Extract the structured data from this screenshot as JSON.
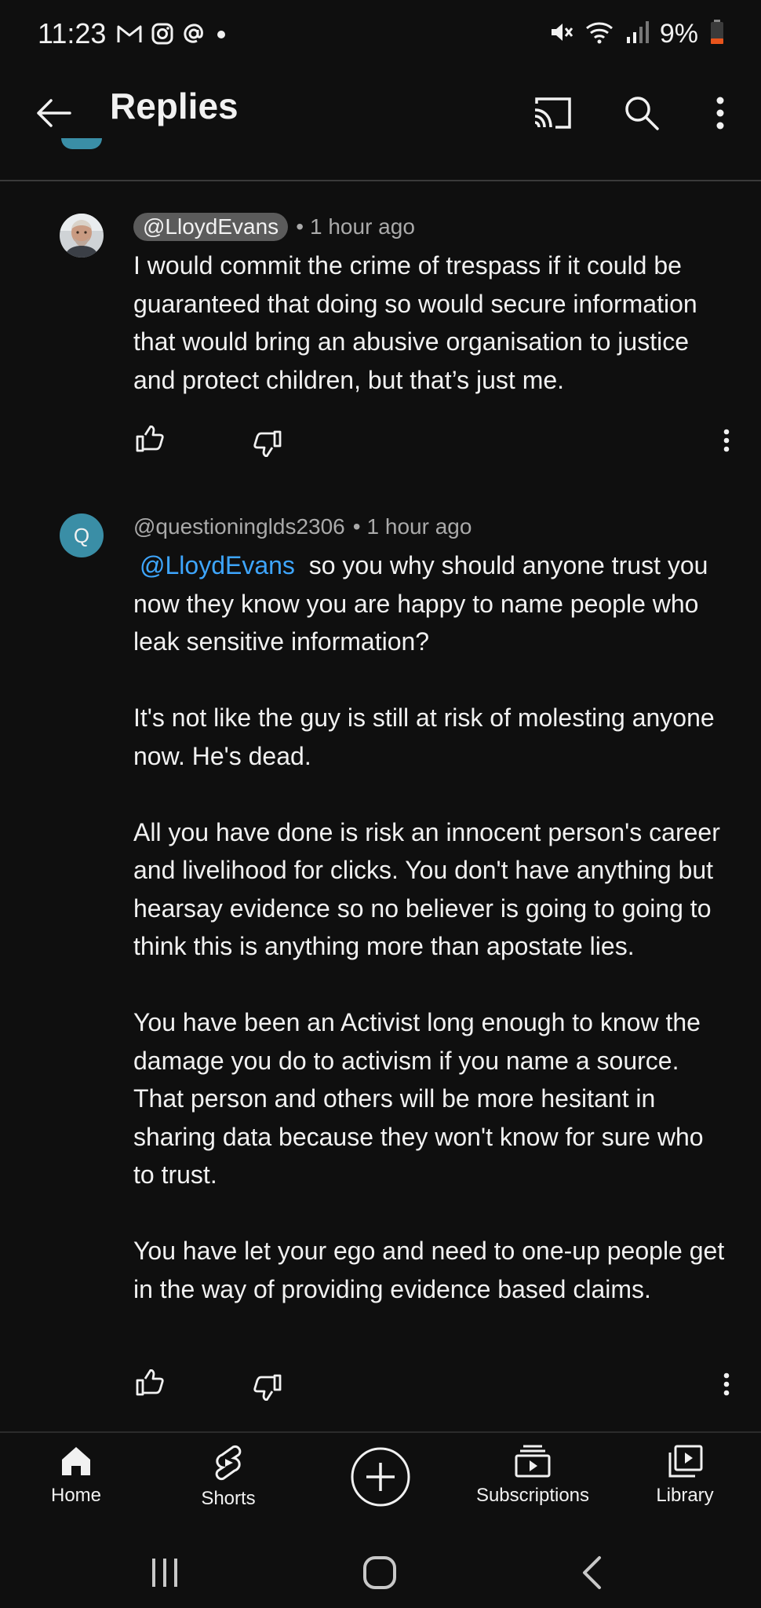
{
  "status_bar": {
    "time": "11:23",
    "battery": "9%",
    "left_icons": [
      "gmail-icon",
      "instagram-icon",
      "threads-icon",
      "notification-dot-icon"
    ],
    "right_icons": [
      "mute-icon",
      "wifi-icon",
      "signal-icon",
      "battery-icon"
    ]
  },
  "app_bar": {
    "title": "Replies",
    "back_icon": "arrow-left-icon",
    "actions": [
      "cast-icon",
      "search-icon",
      "more-vert-icon"
    ]
  },
  "comments": [
    {
      "author": "@LloydEvans",
      "time": "1 hour ago",
      "separator": "•",
      "highlighted_author": true,
      "avatar": "photo",
      "body": [
        "I would commit the crime of trespass if it could be guaranteed that doing so would secure information that would bring an abusive organisation to justice and protect children, but that’s just me."
      ]
    },
    {
      "author": "@questioninglds2306",
      "time": "1 hour ago",
      "separator": "•",
      "highlighted_author": false,
      "avatar_letter": "Q",
      "avatar_color": "#3a8ea6",
      "mention": "@LloydEvans",
      "body": [
        "so you why should anyone trust you now they know you are happy to name people who leak sensitive information?",
        "It's not like the guy is still at risk of molesting anyone now. He's dead.",
        "All you have  done is risk an innocent person's career and livelihood for clicks. You don't have anything but hearsay evidence so  no believer is going to going to think this is anything more than apostate lies.",
        "You have been an Activist long enough to know the damage you do to activism if you name a source. That person and others will be more hesitant in sharing data because they won't know for sure who to trust.",
        "You have let your ego and need to one-up people get in the way of providing evidence based claims."
      ]
    }
  ],
  "bottom_nav": [
    {
      "label": "Home",
      "icon": "home-icon"
    },
    {
      "label": "Shorts",
      "icon": "shorts-icon"
    },
    {
      "label": "",
      "icon": "create-plus-icon"
    },
    {
      "label": "Subscriptions",
      "icon": "subscriptions-icon"
    },
    {
      "label": "Library",
      "icon": "library-icon"
    }
  ],
  "system_nav": [
    "recents-icon",
    "home-circle-icon",
    "back-chevron-icon"
  ],
  "colors": {
    "background": "#0f0f0f",
    "text": "#f1f1f1",
    "secondary_text": "#aaaaaa",
    "mention": "#3ea6ff",
    "author_chip": "#5b5b5b",
    "battery_low": "#e8541c"
  }
}
